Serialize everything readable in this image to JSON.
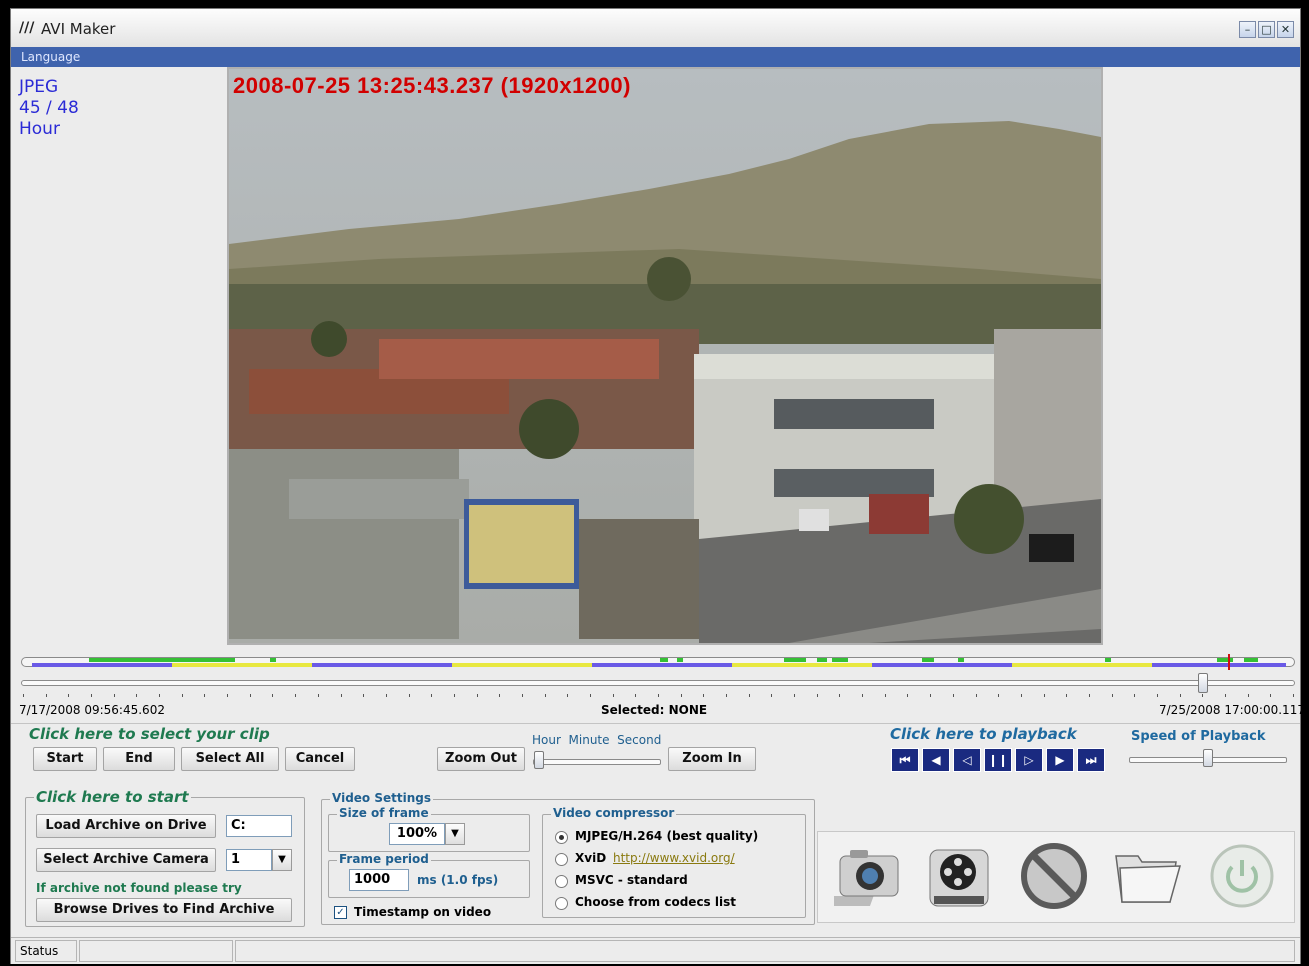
{
  "window": {
    "title": "AVI Maker",
    "controls": [
      "–",
      "□",
      "✕"
    ]
  },
  "menu": {
    "language": "Language"
  },
  "info": {
    "format": "JPEG",
    "count": "45 / 48",
    "unit": "Hour"
  },
  "video": {
    "timestamp": "2008-07-25 13:25:43.237 (1920x1200)"
  },
  "timeline": {
    "start_time": "7/17/2008 09:56:45.602",
    "end_time": "7/25/2008 17:00:00.117",
    "selected": "Selected: NONE",
    "position": 0.93
  },
  "clip": {
    "heading": "Click here to select your clip",
    "start": "Start",
    "end": "End",
    "select_all": "Select All",
    "cancel": "Cancel"
  },
  "zoom": {
    "out": "Zoom Out",
    "in": "Zoom In",
    "scale_labels": "Hour  Minute  Second"
  },
  "playback": {
    "heading": "Click here to playback",
    "speed_label": "Speed of Playback",
    "buttons": [
      "⏮",
      "◀",
      "◁",
      "❙❙",
      "▷",
      "▶",
      "⏭"
    ]
  },
  "start_panel": {
    "heading": "Click here to start",
    "load_archive": "Load Archive on Drive",
    "drive_value": "C:",
    "select_camera": "Select Archive Camera",
    "camera_value": "1",
    "not_found": "If archive not found please try",
    "browse": "Browse Drives to Find Archive"
  },
  "video_settings": {
    "title": "Video Settings",
    "frame_size_label": "Size of frame",
    "frame_size_value": "100%",
    "frame_period_label": "Frame period",
    "frame_period_value": "1000",
    "frame_period_unit": "ms (1.0 fps)",
    "timestamp_label": "Timestamp on video",
    "timestamp_checked": true
  },
  "compressor": {
    "title": "Video compressor",
    "opt1": "MJPEG/H.264 (best quality)",
    "opt2": "XviD",
    "opt2_link": "http://www.xvid.org/",
    "opt3": "MSVC - standard",
    "opt4": "Choose from codecs list",
    "selected": 1
  },
  "status": {
    "label": "Status"
  },
  "colors": {
    "accent": "#3f63ad",
    "green": "#1f7a50",
    "timestamp": "#d10000",
    "playback": "#1a2a80"
  }
}
